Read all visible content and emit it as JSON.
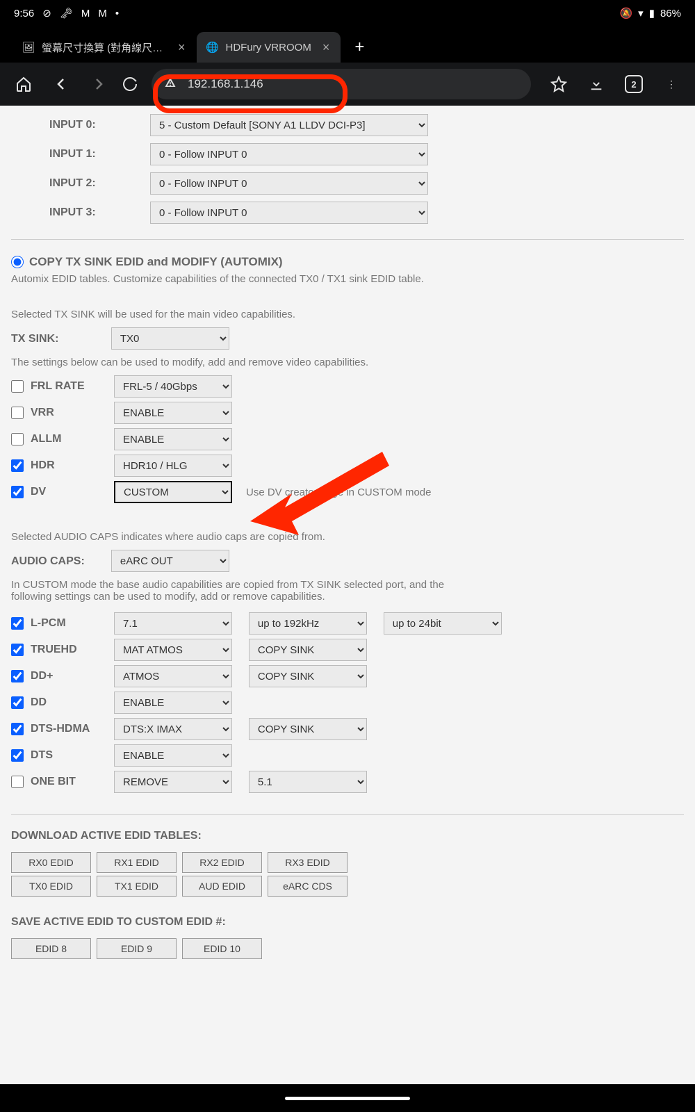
{
  "status": {
    "time": "9:56",
    "battery": "86%"
  },
  "tabs": {
    "t0": "螢幕尺寸換算 (對角線尺寸‧",
    "t1": "HDFury VRROOM"
  },
  "url": "192.168.1.146",
  "tabcount": "2",
  "inputs": {
    "i0_label": "INPUT 0:",
    "i0_val": "5 - Custom Default [SONY A1 LLDV DCI-P3]",
    "i1_label": "INPUT 1:",
    "i1_val": "0 - Follow INPUT 0",
    "i2_label": "INPUT 2:",
    "i2_val": "0 - Follow INPUT 0",
    "i3_label": "INPUT 3:",
    "i3_val": "0 - Follow INPUT 0"
  },
  "automix": {
    "title": "COPY TX SINK EDID and MODIFY (AUTOMIX)",
    "desc": "Automix EDID tables. Customize capabilities of the connected TX0 / TX1 sink EDID table.",
    "sink_note": "Selected TX SINK will be used for the main video capabilities.",
    "tx_sink_label": "TX SINK:",
    "tx_sink": "TX0",
    "mod_note": "The settings below can be used to modify, add and remove video capabilities.",
    "frl_label": "FRL RATE",
    "frl": "FRL-5 / 40Gbps",
    "vrr_label": "VRR",
    "vrr": "ENABLE",
    "allm_label": "ALLM",
    "allm": "ENABLE",
    "hdr_label": "HDR",
    "hdr": "HDR10 / HLG",
    "dv_label": "DV",
    "dv": "CUSTOM",
    "dv_hint": "Use DV creator page in CUSTOM mode"
  },
  "audio": {
    "note1": "Selected AUDIO CAPS indicates where audio caps are copied from.",
    "caps_label": "AUDIO CAPS:",
    "caps": "eARC OUT",
    "note2": "In CUSTOM mode the base audio capabilities are copied from TX SINK selected port, and the following settings can be used to modify, add or remove capabilities.",
    "lpcm_label": "L-PCM",
    "lpcm1": "7.1",
    "lpcm2": "up to 192kHz",
    "lpcm3": "up to 24bit",
    "truehd_label": "TRUEHD",
    "truehd1": "MAT ATMOS",
    "truehd2": "COPY SINK",
    "ddp_label": "DD+",
    "ddp1": "ATMOS",
    "ddp2": "COPY SINK",
    "dd_label": "DD",
    "dd1": "ENABLE",
    "dtshdma_label": "DTS-HDMA",
    "dtshdma1": "DTS:X IMAX",
    "dtshdma2": "COPY SINK",
    "dts_label": "DTS",
    "dts1": "ENABLE",
    "onebit_label": "ONE BIT",
    "onebit1": "REMOVE",
    "onebit2": "5.1"
  },
  "download": {
    "title": "DOWNLOAD ACTIVE EDID TABLES:",
    "b0": "RX0 EDID",
    "b1": "RX1 EDID",
    "b2": "RX2 EDID",
    "b3": "RX3 EDID",
    "b4": "TX0 EDID",
    "b5": "TX1 EDID",
    "b6": "AUD EDID",
    "b7": "eARC CDS"
  },
  "save": {
    "title": "SAVE ACTIVE EDID TO CUSTOM EDID #:",
    "b0": "EDID 8",
    "b1": "EDID 9",
    "b2": "EDID 10"
  }
}
